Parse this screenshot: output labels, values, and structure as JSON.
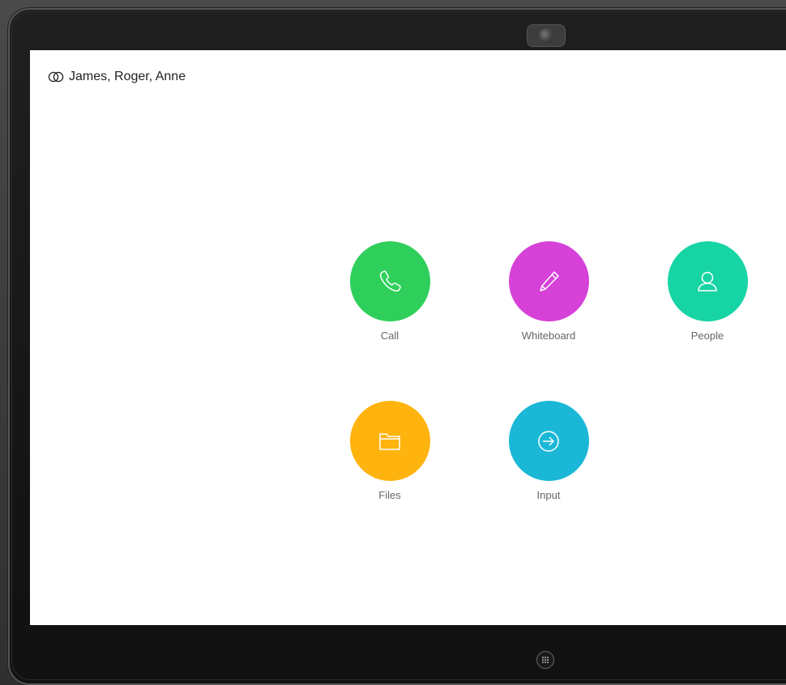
{
  "header": {
    "participants": "James, Roger, Anne",
    "icon": "participants-rings-icon"
  },
  "tiles": [
    {
      "label": "Call",
      "icon": "phone-icon",
      "color": "#2ecf5a"
    },
    {
      "label": "Whiteboard",
      "icon": "pencil-icon",
      "color": "#d641d8"
    },
    {
      "label": "People",
      "icon": "person-icon",
      "color": "#17d4a4"
    },
    {
      "label": "Files",
      "icon": "folder-icon",
      "color": "#ffb30e"
    },
    {
      "label": "Input",
      "icon": "arrow-right-circle-icon",
      "color": "#1ab8d6"
    }
  ],
  "device": {
    "home_button_icon": "grid-dots-icon"
  }
}
